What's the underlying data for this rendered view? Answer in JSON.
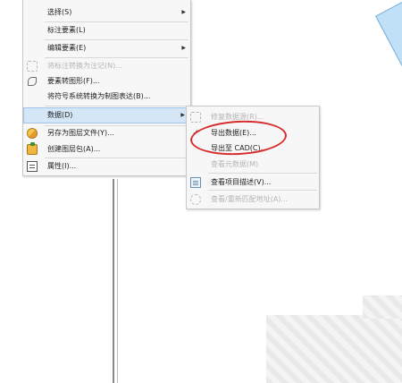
{
  "main_menu": {
    "items": [
      {
        "label": "选择(S)",
        "has_submenu": true
      },
      {
        "label": "标注要素(L)"
      },
      {
        "label": "编辑要素(E)",
        "has_submenu": true
      },
      {
        "label": "将标注转换为注记(N)...",
        "disabled": true
      },
      {
        "label": "要素转图形(F)..."
      },
      {
        "label": "将符号系统转换为制图表达(B)..."
      },
      {
        "label": "数据(D)",
        "has_submenu": true
      },
      {
        "label": "另存为图层文件(Y)..."
      },
      {
        "label": "创建图层包(A)..."
      },
      {
        "label": "属性(I)..."
      }
    ]
  },
  "data_submenu": {
    "items": [
      {
        "label": "修复数据源(R)...",
        "disabled": true
      },
      {
        "label": "导出数据(E)..."
      },
      {
        "label": "导出至 CAD(C)..."
      },
      {
        "label": "查看元数据(M)",
        "disabled": true
      },
      {
        "label": "查看项目描述(V)..."
      },
      {
        "label": "查看/重新匹配地址(A)...",
        "disabled": true
      }
    ]
  },
  "colors": {
    "highlight": "#d5e6f7",
    "annotation_ellipse": "#d62c2c"
  }
}
